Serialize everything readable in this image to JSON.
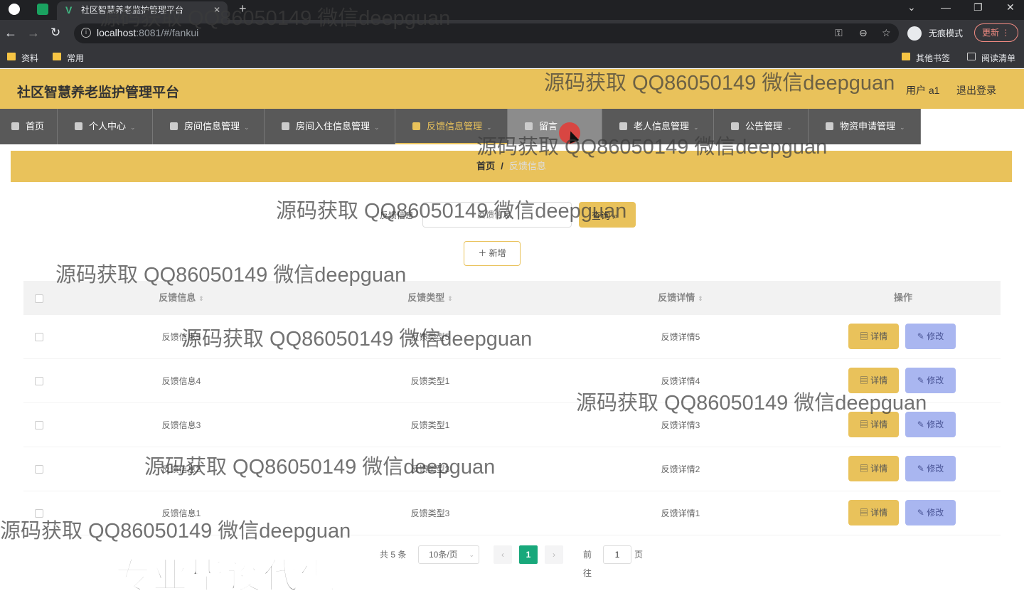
{
  "browser": {
    "tab_title": "社区智慧养老监护管理平台",
    "url_host": "localhost",
    "url_rest": ":8081/#/fankui",
    "incognito_label": "无痕模式",
    "update_label": "更新",
    "bookmarks": [
      "资料",
      "常用"
    ],
    "other_bookmarks": "其他书签",
    "reading_list": "阅读清单"
  },
  "header": {
    "title": "社区智慧养老监护管理平台",
    "user": "用户 a1",
    "logout": "退出登录"
  },
  "nav": {
    "items": [
      {
        "label": "首页"
      },
      {
        "label": "个人中心"
      },
      {
        "label": "房间信息管理"
      },
      {
        "label": "房间入住信息管理"
      },
      {
        "label": "反馈信息管理"
      },
      {
        "label": "留言"
      },
      {
        "label": "老人信息管理"
      },
      {
        "label": "公告管理"
      },
      {
        "label": "物资申请管理"
      }
    ]
  },
  "breadcrumb": {
    "home": "首页",
    "separator": "/",
    "current": "反馈信息"
  },
  "search": {
    "label": "反馈信息",
    "placeholder": "反馈信息",
    "button": "查询"
  },
  "add_button": "＋ 新增",
  "table": {
    "headers": [
      "反馈信息",
      "反馈类型",
      "反馈详情",
      "操作"
    ],
    "rows": [
      {
        "info": "反馈信息5",
        "type": "反馈类型5",
        "detail": "反馈详情5"
      },
      {
        "info": "反馈信息4",
        "type": "反馈类型1",
        "detail": "反馈详情4"
      },
      {
        "info": "反馈信息3",
        "type": "反馈类型1",
        "detail": "反馈详情3"
      },
      {
        "info": "反馈信息2",
        "type": "反馈类型3",
        "detail": "反馈详情2"
      },
      {
        "info": "反馈信息1",
        "type": "反馈类型3",
        "detail": "反馈详情1"
      }
    ],
    "detail_button": "详情",
    "edit_button": "修改"
  },
  "pagination": {
    "total": "共 5 条",
    "page_size": "10条/页",
    "current_page": "1",
    "goto_label": "前往",
    "goto_value": "1",
    "page_suffix": "页"
  },
  "watermarks": {
    "line": "源码获取 QQ86050149 微信deepguan",
    "banner": "专业毕设代做"
  },
  "colors": {
    "accent": "#e9c25b",
    "nav_bg": "#595959",
    "edit_button": "#a9b6f0",
    "pager_active": "#18a87b"
  }
}
